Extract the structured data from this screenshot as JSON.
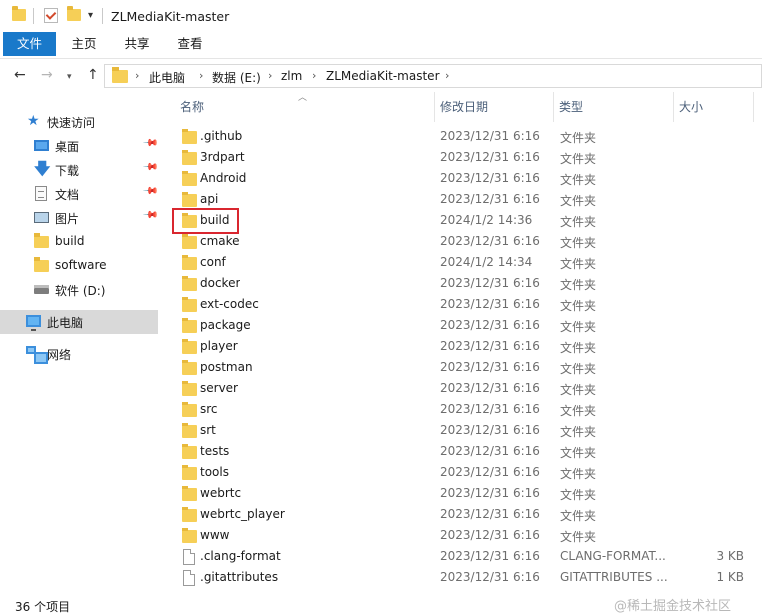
{
  "window": {
    "title": "ZLMediaKit-master"
  },
  "ribbon": {
    "tabs": [
      "文件",
      "主页",
      "共享",
      "查看"
    ]
  },
  "address": {
    "segments": [
      "此电脑",
      "数据 (E:)",
      "zlm",
      "ZLMediaKit-master"
    ]
  },
  "sidebar": {
    "quick_access": "快速访问",
    "items": [
      {
        "label": "桌面",
        "icon": "desktop-icon",
        "pinned": true
      },
      {
        "label": "下载",
        "icon": "download-icon",
        "pinned": true
      },
      {
        "label": "文档",
        "icon": "document-icon",
        "pinned": true
      },
      {
        "label": "图片",
        "icon": "picture-icon",
        "pinned": true
      },
      {
        "label": "build",
        "icon": "folder-icon",
        "pinned": false
      },
      {
        "label": "software",
        "icon": "folder-icon",
        "pinned": false
      },
      {
        "label": "软件 (D:)",
        "icon": "drive-icon",
        "pinned": false
      }
    ],
    "this_pc": "此电脑",
    "network": "网络"
  },
  "columns": {
    "name": "名称",
    "date": "修改日期",
    "type": "类型",
    "size": "大小"
  },
  "files": [
    {
      "name": ".github",
      "date": "2023/12/31 6:16",
      "type": "文件夹",
      "size": "",
      "kind": "folder"
    },
    {
      "name": "3rdpart",
      "date": "2023/12/31 6:16",
      "type": "文件夹",
      "size": "",
      "kind": "folder"
    },
    {
      "name": "Android",
      "date": "2023/12/31 6:16",
      "type": "文件夹",
      "size": "",
      "kind": "folder"
    },
    {
      "name": "api",
      "date": "2023/12/31 6:16",
      "type": "文件夹",
      "size": "",
      "kind": "folder"
    },
    {
      "name": "build",
      "date": "2024/1/2 14:36",
      "type": "文件夹",
      "size": "",
      "kind": "folder"
    },
    {
      "name": "cmake",
      "date": "2023/12/31 6:16",
      "type": "文件夹",
      "size": "",
      "kind": "folder"
    },
    {
      "name": "conf",
      "date": "2024/1/2 14:34",
      "type": "文件夹",
      "size": "",
      "kind": "folder"
    },
    {
      "name": "docker",
      "date": "2023/12/31 6:16",
      "type": "文件夹",
      "size": "",
      "kind": "folder"
    },
    {
      "name": "ext-codec",
      "date": "2023/12/31 6:16",
      "type": "文件夹",
      "size": "",
      "kind": "folder"
    },
    {
      "name": "package",
      "date": "2023/12/31 6:16",
      "type": "文件夹",
      "size": "",
      "kind": "folder"
    },
    {
      "name": "player",
      "date": "2023/12/31 6:16",
      "type": "文件夹",
      "size": "",
      "kind": "folder"
    },
    {
      "name": "postman",
      "date": "2023/12/31 6:16",
      "type": "文件夹",
      "size": "",
      "kind": "folder"
    },
    {
      "name": "server",
      "date": "2023/12/31 6:16",
      "type": "文件夹",
      "size": "",
      "kind": "folder"
    },
    {
      "name": "src",
      "date": "2023/12/31 6:16",
      "type": "文件夹",
      "size": "",
      "kind": "folder"
    },
    {
      "name": "srt",
      "date": "2023/12/31 6:16",
      "type": "文件夹",
      "size": "",
      "kind": "folder"
    },
    {
      "name": "tests",
      "date": "2023/12/31 6:16",
      "type": "文件夹",
      "size": "",
      "kind": "folder"
    },
    {
      "name": "tools",
      "date": "2023/12/31 6:16",
      "type": "文件夹",
      "size": "",
      "kind": "folder"
    },
    {
      "name": "webrtc",
      "date": "2023/12/31 6:16",
      "type": "文件夹",
      "size": "",
      "kind": "folder"
    },
    {
      "name": "webrtc_player",
      "date": "2023/12/31 6:16",
      "type": "文件夹",
      "size": "",
      "kind": "folder"
    },
    {
      "name": "www",
      "date": "2023/12/31 6:16",
      "type": "文件夹",
      "size": "",
      "kind": "folder"
    },
    {
      "name": ".clang-format",
      "date": "2023/12/31 6:16",
      "type": "CLANG-FORMAT...",
      "size": "3 KB",
      "kind": "file"
    },
    {
      "name": ".gitattributes",
      "date": "2023/12/31 6:16",
      "type": "GITATTRIBUTES ...",
      "size": "1 KB",
      "kind": "file"
    }
  ],
  "status": {
    "count": "36 个项目"
  },
  "watermark": "@稀土掘金技术社区",
  "colors": {
    "accent": "#1979ca",
    "highlight": "#d9262f",
    "folder": "#f6cf57"
  }
}
